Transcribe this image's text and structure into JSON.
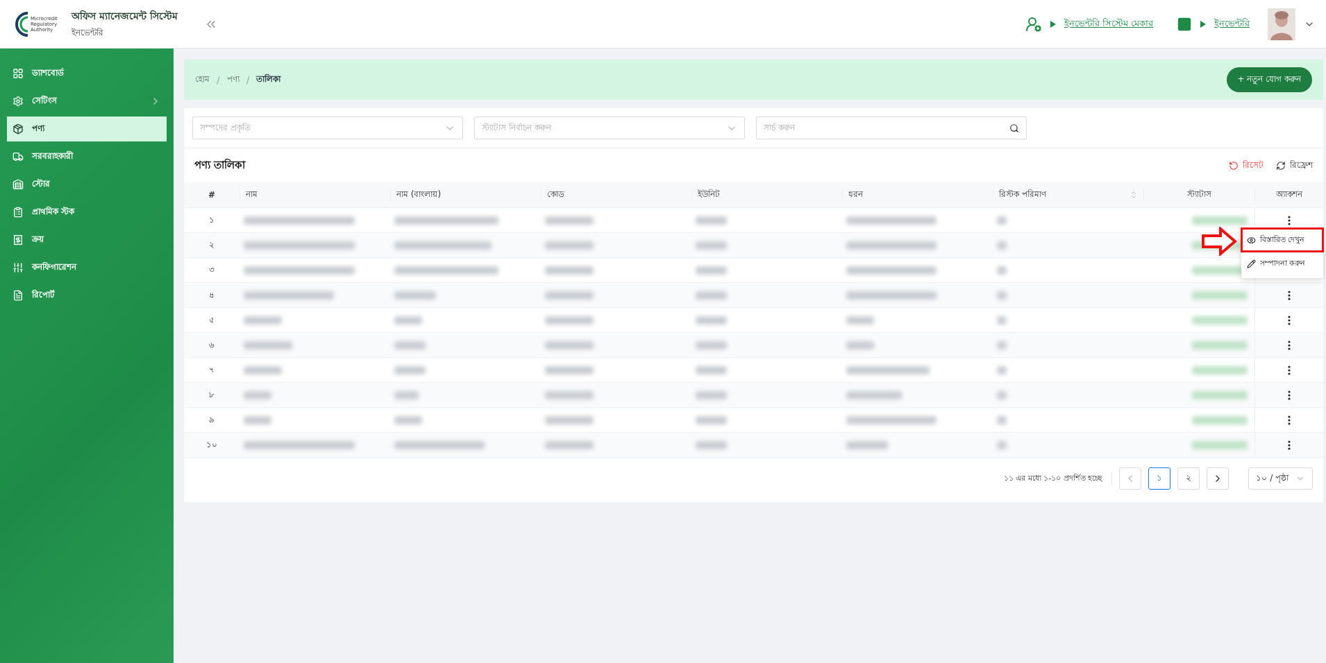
{
  "header": {
    "logo_lines": [
      "Microcredit",
      "Regulatory",
      "Authority"
    ],
    "title": "অফিস ম্যানেজমেন্ট সিস্টেম",
    "subtitle": "ইনভেন্টরি",
    "links": [
      "ইনভেন্টরি সিস্টেম মেকার",
      "ইনভেন্টরি"
    ]
  },
  "sidebar": {
    "items": [
      {
        "label": "ড্যাশবোর্ড",
        "selected": false
      },
      {
        "label": "সেটিংস",
        "selected": false,
        "expandable": true
      },
      {
        "label": "পণ্য",
        "selected": true
      },
      {
        "label": "সরবরাহকারী",
        "selected": false
      },
      {
        "label": "স্টোর",
        "selected": false
      },
      {
        "label": "প্রাথমিক স্টক",
        "selected": false
      },
      {
        "label": "ক্রয়",
        "selected": false
      },
      {
        "label": "কনফিগারেশন",
        "selected": false
      },
      {
        "label": "রিপোর্ট",
        "selected": false
      }
    ]
  },
  "breadcrumb": {
    "items": [
      "হোম",
      "পণ্য",
      "তালিকা"
    ],
    "separator": "/"
  },
  "add_button": "+ নতুন যোগ করুন",
  "filters": [
    {
      "placeholder": "সম্পদের প্রকৃতি",
      "kind": "select"
    },
    {
      "placeholder": "স্ট্যাটাস নির্বাচন করুন",
      "kind": "select"
    },
    {
      "placeholder": "সার্চ করুন",
      "kind": "search"
    }
  ],
  "table": {
    "title": "পণ্য তালিকা",
    "reset": "রিসেট",
    "refresh": "রিফ্রেশ",
    "columns": [
      {
        "label": "#",
        "sortable": false
      },
      {
        "label": "নাম",
        "sortable": false
      },
      {
        "label": "নাম (বাংলায়)",
        "sortable": false
      },
      {
        "label": "কোড",
        "sortable": false
      },
      {
        "label": "ইউনিট",
        "sortable": false
      },
      {
        "label": "ধরন",
        "sortable": false
      },
      {
        "label": "রিস্টক পরিমাণ",
        "sortable": true
      },
      {
        "label": "স্ট্যাটাস",
        "sortable": false
      },
      {
        "label": "অ্যাকশন",
        "sortable": false
      }
    ],
    "rows": [
      {
        "number": "১"
      },
      {
        "number": "২"
      },
      {
        "number": "৩"
      },
      {
        "number": "৪"
      },
      {
        "number": "৫"
      },
      {
        "number": "৬"
      },
      {
        "number": "৭"
      },
      {
        "number": "৮"
      },
      {
        "number": "৯"
      },
      {
        "number": "১০"
      }
    ]
  },
  "action_menu": {
    "open": true,
    "items": [
      {
        "label": "বিস্তারিত দেখুন",
        "highlighted": true
      },
      {
        "label": "সম্পাদনা করুন",
        "highlighted": false
      }
    ]
  },
  "pagination": {
    "summary": "১১ এর মধ্যে ১-১০ প্রদর্শিত হচ্ছে",
    "pages": [
      {
        "label": "১",
        "selected": true
      },
      {
        "label": "২",
        "selected": false
      }
    ],
    "page_size": "১০ / পৃষ্ঠা"
  }
}
